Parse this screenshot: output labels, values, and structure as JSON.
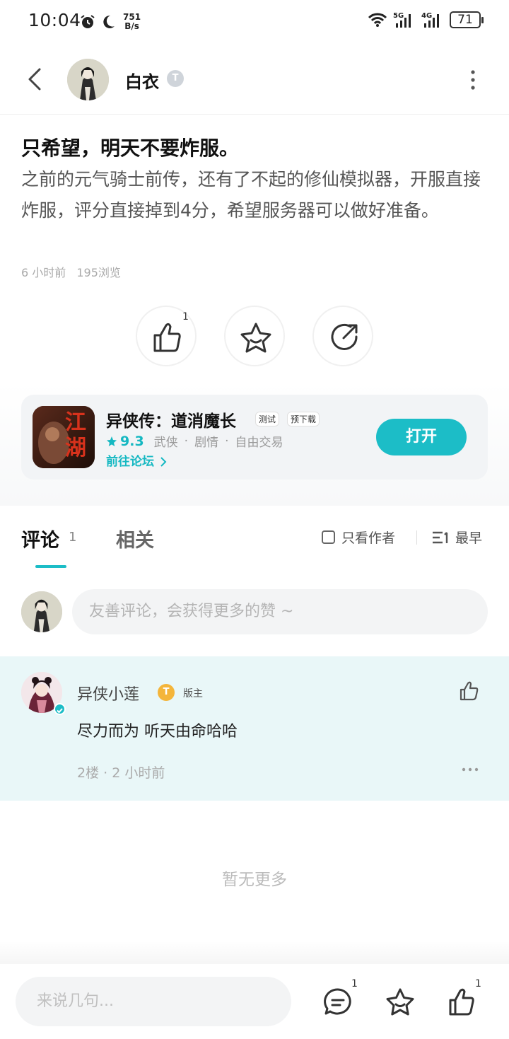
{
  "status_bar": {
    "time": "10:04",
    "net_speed_value": "751",
    "net_speed_unit": "B/s",
    "battery": "71"
  },
  "header": {
    "author_name": "白衣",
    "level_badge": "T"
  },
  "post": {
    "title": "只希望，明天不要炸服。",
    "body": "之前的元气骑士前传，还有了不起的修仙模拟器，开服直接炸服，评分直接掉到4分，希望服务器可以做好准备。",
    "time": "6 小时前",
    "views": "195浏览",
    "like_count": "1"
  },
  "game_card": {
    "title": "异侠传：道消魔长",
    "tags": [
      "测试",
      "预下载"
    ],
    "rating": "9.3",
    "genres": [
      "武侠",
      "剧情",
      "自由交易"
    ],
    "forum_link": "前往论坛",
    "open_label": "打开",
    "icon_text": "江湖"
  },
  "tabs": {
    "comment_label": "评论",
    "comment_count": "1",
    "related_label": "相关",
    "author_only_label": "只看作者",
    "sort_label": "最早"
  },
  "comment_input": {
    "placeholder": "友善评论，会获得更多的赞 ~"
  },
  "comment": {
    "user_name": "异侠小莲",
    "level_badge": "T",
    "role": "版主",
    "text": "尽力而为 听天由命哈哈",
    "floor": "2楼",
    "time": "2 小时前"
  },
  "no_more_text": "暂无更多",
  "bottom_bar": {
    "input_placeholder": "来说几句...",
    "comment_count": "1",
    "like_count": "1"
  },
  "colors": {
    "accent": "#1cbdc7",
    "comment_bg": "#e9f7f8",
    "level_gold": "#f4b53a"
  },
  "icons": [
    "alarm-icon",
    "moon-icon",
    "wifi-icon",
    "signal-icon",
    "battery-icon",
    "back-arrow-icon",
    "more-vertical-icon",
    "thumbs-up-icon",
    "star-icon",
    "share-icon",
    "chevron-right-icon",
    "sort-icon",
    "ellipsis-icon",
    "comment-icon"
  ]
}
